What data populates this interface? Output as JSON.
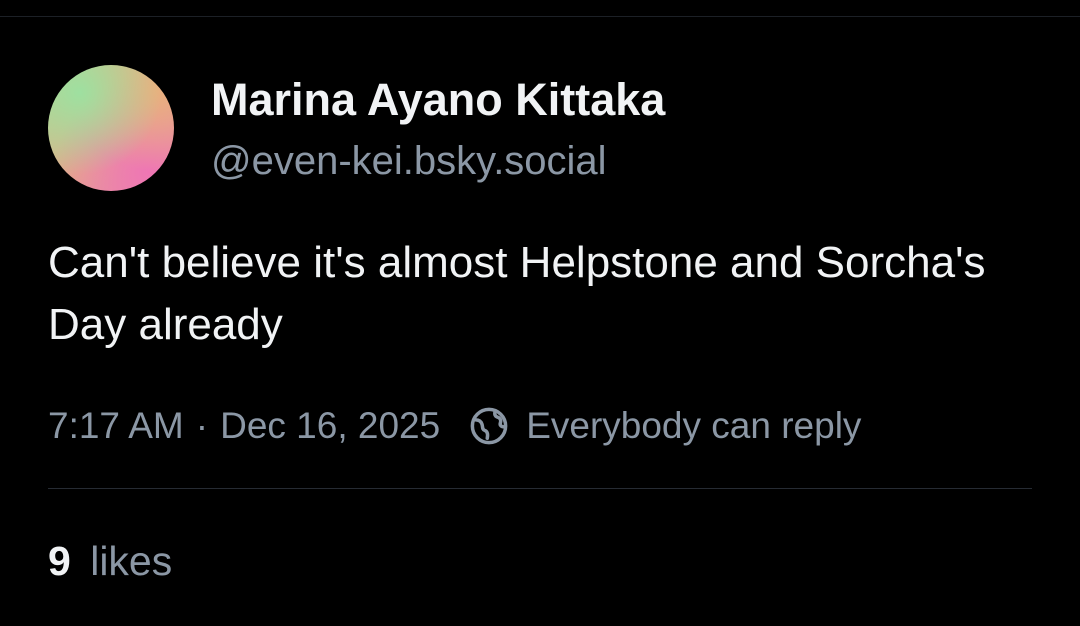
{
  "author": {
    "display_name": "Marina Ayano Kittaka",
    "handle": "@even-kei.bsky.social"
  },
  "post": {
    "text": "Can't believe it's almost Helpstone and Sorcha's Day already",
    "time": "7:17 AM",
    "separator": "·",
    "date": "Dec 16, 2025",
    "reply_setting": "Everybody can reply",
    "reply_icon": "globe-icon"
  },
  "stats": {
    "likes_count": "9",
    "likes_label": "likes"
  },
  "colors": {
    "background": "#000000",
    "primary_text": "#f1f3f5",
    "secondary_text": "#8b97a5",
    "divider": "#262b33"
  }
}
